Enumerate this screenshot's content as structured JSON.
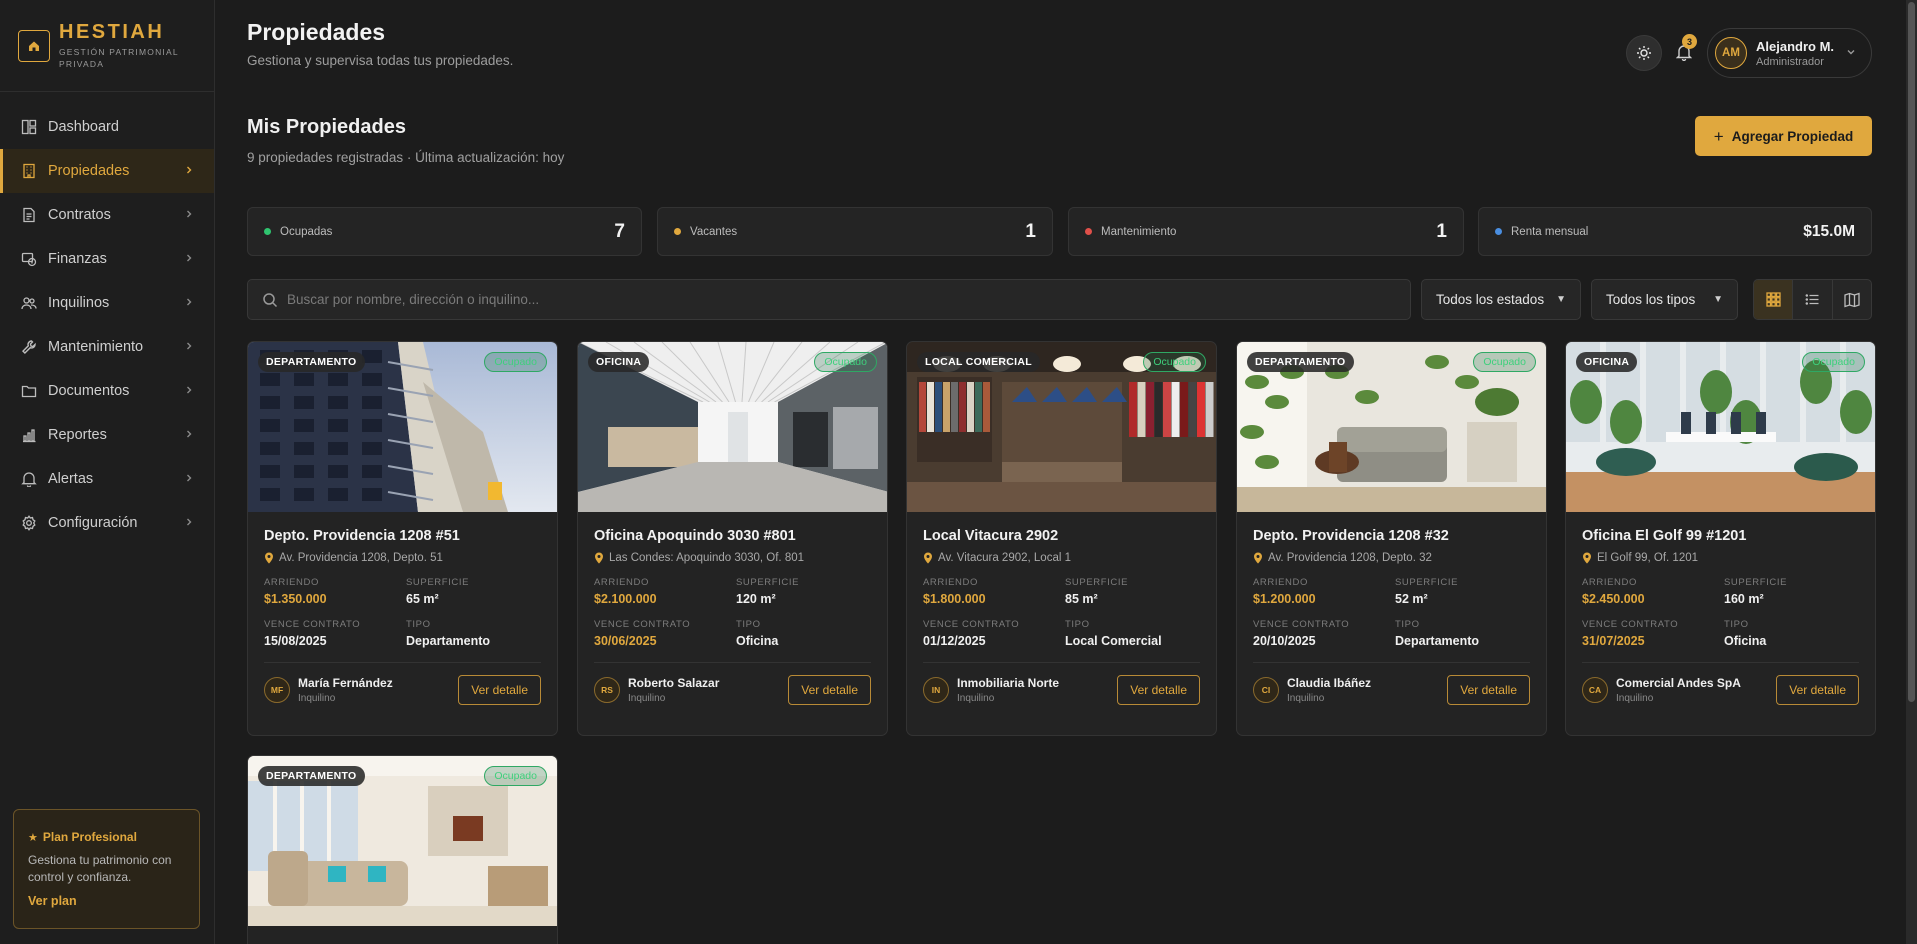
{
  "brand": {
    "name": "HESTIAH",
    "tagline": "GESTIÓN PATRIMONIAL PRIVADA"
  },
  "sidebar": {
    "items": [
      {
        "label": "Dashboard",
        "icon": "dashboard-icon",
        "active": false,
        "chevron": false
      },
      {
        "label": "Propiedades",
        "icon": "building-icon",
        "active": true,
        "chevron": true
      },
      {
        "label": "Contratos",
        "icon": "document-icon",
        "active": false,
        "chevron": true
      },
      {
        "label": "Finanzas",
        "icon": "finance-icon",
        "active": false,
        "chevron": true
      },
      {
        "label": "Inquilinos",
        "icon": "users-icon",
        "active": false,
        "chevron": true
      },
      {
        "label": "Mantenimiento",
        "icon": "wrench-icon",
        "active": false,
        "chevron": true
      },
      {
        "label": "Documentos",
        "icon": "folder-icon",
        "active": false,
        "chevron": true
      },
      {
        "label": "Reportes",
        "icon": "chart-icon",
        "active": false,
        "chevron": true
      },
      {
        "label": "Alertas",
        "icon": "bell-icon",
        "active": false,
        "chevron": true
      },
      {
        "label": "Configuración",
        "icon": "gear-icon",
        "active": false,
        "chevron": true
      }
    ],
    "plan": {
      "title": "Plan Profesional",
      "description": "Gestiona tu patrimonio con control y confianza.",
      "link": "Ver plan"
    }
  },
  "header": {
    "title": "Propiedades",
    "subtitle": "Gestiona y supervisa todas tus propiedades.",
    "notifications": "3",
    "user": {
      "initials": "AM",
      "name": "Alejandro M.",
      "role": "Administrador"
    }
  },
  "section": {
    "title": "Mis Propiedades",
    "subtitle": "9 propiedades registradas · Última actualización: hoy",
    "add_button": "Agregar Propiedad"
  },
  "stats": [
    {
      "label": "Ocupadas",
      "value": "7",
      "color": "#2fc46f"
    },
    {
      "label": "Vacantes",
      "value": "1",
      "color": "#e0a83e"
    },
    {
      "label": "Mantenimiento",
      "value": "1",
      "color": "#e0504a"
    },
    {
      "label": "Renta mensual",
      "value": "$15.0M",
      "color": "#4a8ee0"
    }
  ],
  "filters": {
    "search_placeholder": "Buscar por nombre, dirección o inquilino...",
    "status_select": "Todos los estados",
    "type_select": "Todos los tipos",
    "view_modes": [
      "grid-view-icon",
      "list-view-icon",
      "map-view-icon"
    ],
    "active_view": "grid-view-icon"
  },
  "labels": {
    "rent": "ARRIENDO",
    "area": "SUPERFICIE",
    "contract_end": "VENCE CONTRATO",
    "type": "TIPO",
    "tenant_role": "Inquilino",
    "detail_button": "Ver detalle"
  },
  "properties": [
    {
      "tag": "DEPARTAMENTO",
      "status": "Ocupado",
      "title": "Depto. Providencia 1208 #51",
      "address": "Av. Providencia 1208, Depto. 51",
      "rent": "$1.350.000",
      "area": "65 m²",
      "contract_end": "15/08/2025",
      "contract_warn": false,
      "type": "Departamento",
      "tenant_initials": "MF",
      "tenant": "María Fernández",
      "image": "apartment-building"
    },
    {
      "tag": "OFICINA",
      "status": "Ocupado",
      "title": "Oficina Apoquindo 3030 #801",
      "address": "Las Condes: Apoquindo 3030, Of. 801",
      "rent": "$2.100.000",
      "area": "120 m²",
      "contract_end": "30/06/2025",
      "contract_warn": true,
      "type": "Oficina",
      "tenant_initials": "RS",
      "tenant": "Roberto Salazar",
      "image": "office-hallway"
    },
    {
      "tag": "LOCAL COMERCIAL",
      "status": "Ocupado",
      "title": "Local Vitacura 2902",
      "address": "Av. Vitacura 2902, Local 1",
      "rent": "$1.800.000",
      "area": "85 m²",
      "contract_end": "01/12/2025",
      "contract_warn": false,
      "type": "Local Comercial",
      "tenant_initials": "IN",
      "tenant": "Inmobiliaria Norte",
      "image": "clothing-store"
    },
    {
      "tag": "DEPARTAMENTO",
      "status": "Ocupado",
      "title": "Depto. Providencia 1208 #32",
      "address": "Av. Providencia 1208, Depto. 32",
      "rent": "$1.200.000",
      "area": "52 m²",
      "contract_end": "20/10/2025",
      "contract_warn": false,
      "type": "Departamento",
      "tenant_initials": "CI",
      "tenant": "Claudia Ibáñez",
      "image": "living-room-plants"
    },
    {
      "tag": "OFICINA",
      "status": "Ocupado",
      "title": "Oficina El Golf 99 #1201",
      "address": "El Golf 99, Of. 1201",
      "rent": "$2.450.000",
      "area": "160 m²",
      "contract_end": "31/07/2025",
      "contract_warn": true,
      "type": "Oficina",
      "tenant_initials": "CA",
      "tenant": "Comercial Andes SpA",
      "image": "coworking-office"
    },
    {
      "tag": "DEPARTAMENTO",
      "status": "Ocupado",
      "image": "bright-living-room"
    }
  ]
}
